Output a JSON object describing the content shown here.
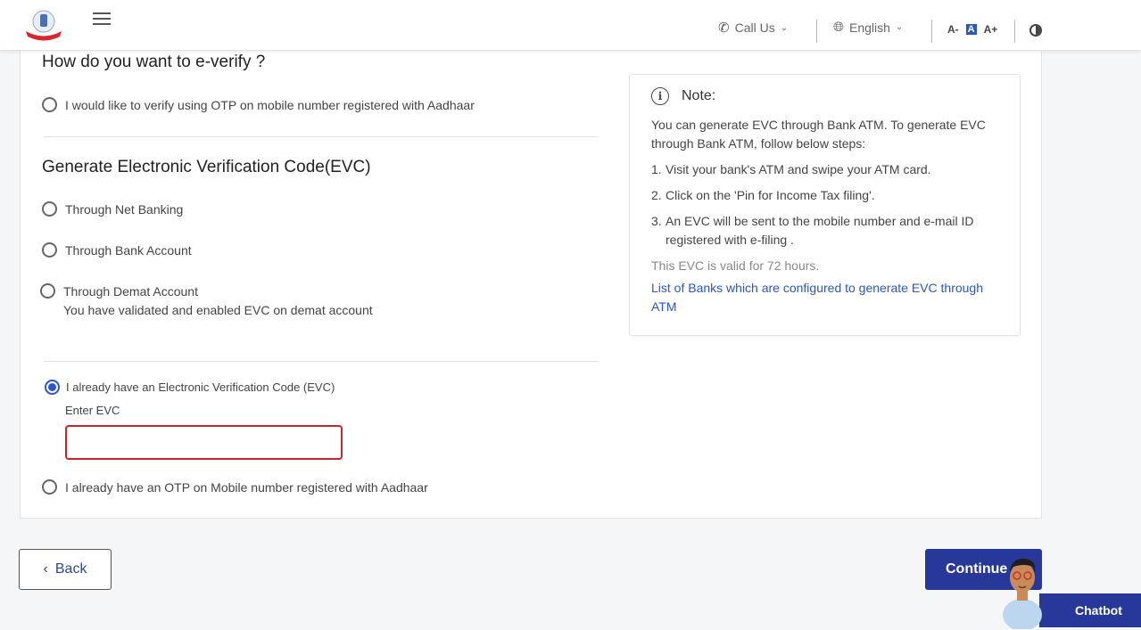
{
  "header": {
    "call_us": "Call Us",
    "language": "English",
    "font_controls": [
      "A-",
      "A",
      "A+"
    ]
  },
  "main": {
    "title": "How do you want to e-verify ?",
    "aadhaar_otp_option": "I would like to verify using OTP on mobile number registered with Aadhaar",
    "evc_section_title": "Generate Electronic Verification Code(EVC)",
    "evc_options": [
      {
        "label": "Through Net Banking",
        "selected": false
      },
      {
        "label": "Through Bank Account",
        "selected": false
      },
      {
        "label": "Through Demat Account",
        "selected": false
      }
    ],
    "demat_note": "You have validated and enabled EVC on demat account",
    "have_evc_option": "I already have an Electronic Verification Code (EVC)",
    "have_evc_selected": true,
    "enter_evc_label": "Enter EVC",
    "evc_value": "",
    "have_otp_option": "I already have an OTP on Mobile number registered with Aadhaar"
  },
  "note": {
    "title": "Note:",
    "intro": "You can generate EVC through Bank ATM. To generate EVC through Bank ATM, follow below steps:",
    "steps": [
      {
        "num": "1.",
        "text": "Visit your bank's ATM and swipe your ATM card."
      },
      {
        "num": "2.",
        "text": "Click on the 'Pin for Income Tax filing'."
      },
      {
        "num": "3.",
        "text": "An EVC will be sent to the mobile number and e-mail ID registered with e-filing ."
      }
    ],
    "validity": "This EVC is valid for 72 hours.",
    "link": "List of Banks which are configured to generate EVC through ATM"
  },
  "footer": {
    "back_label": "Back",
    "continue_label": "Continue",
    "chatbot_label": "Chatbot"
  },
  "colors": {
    "primary": "#27389a",
    "link": "#2b56c6",
    "error_border": "#c8262c"
  }
}
